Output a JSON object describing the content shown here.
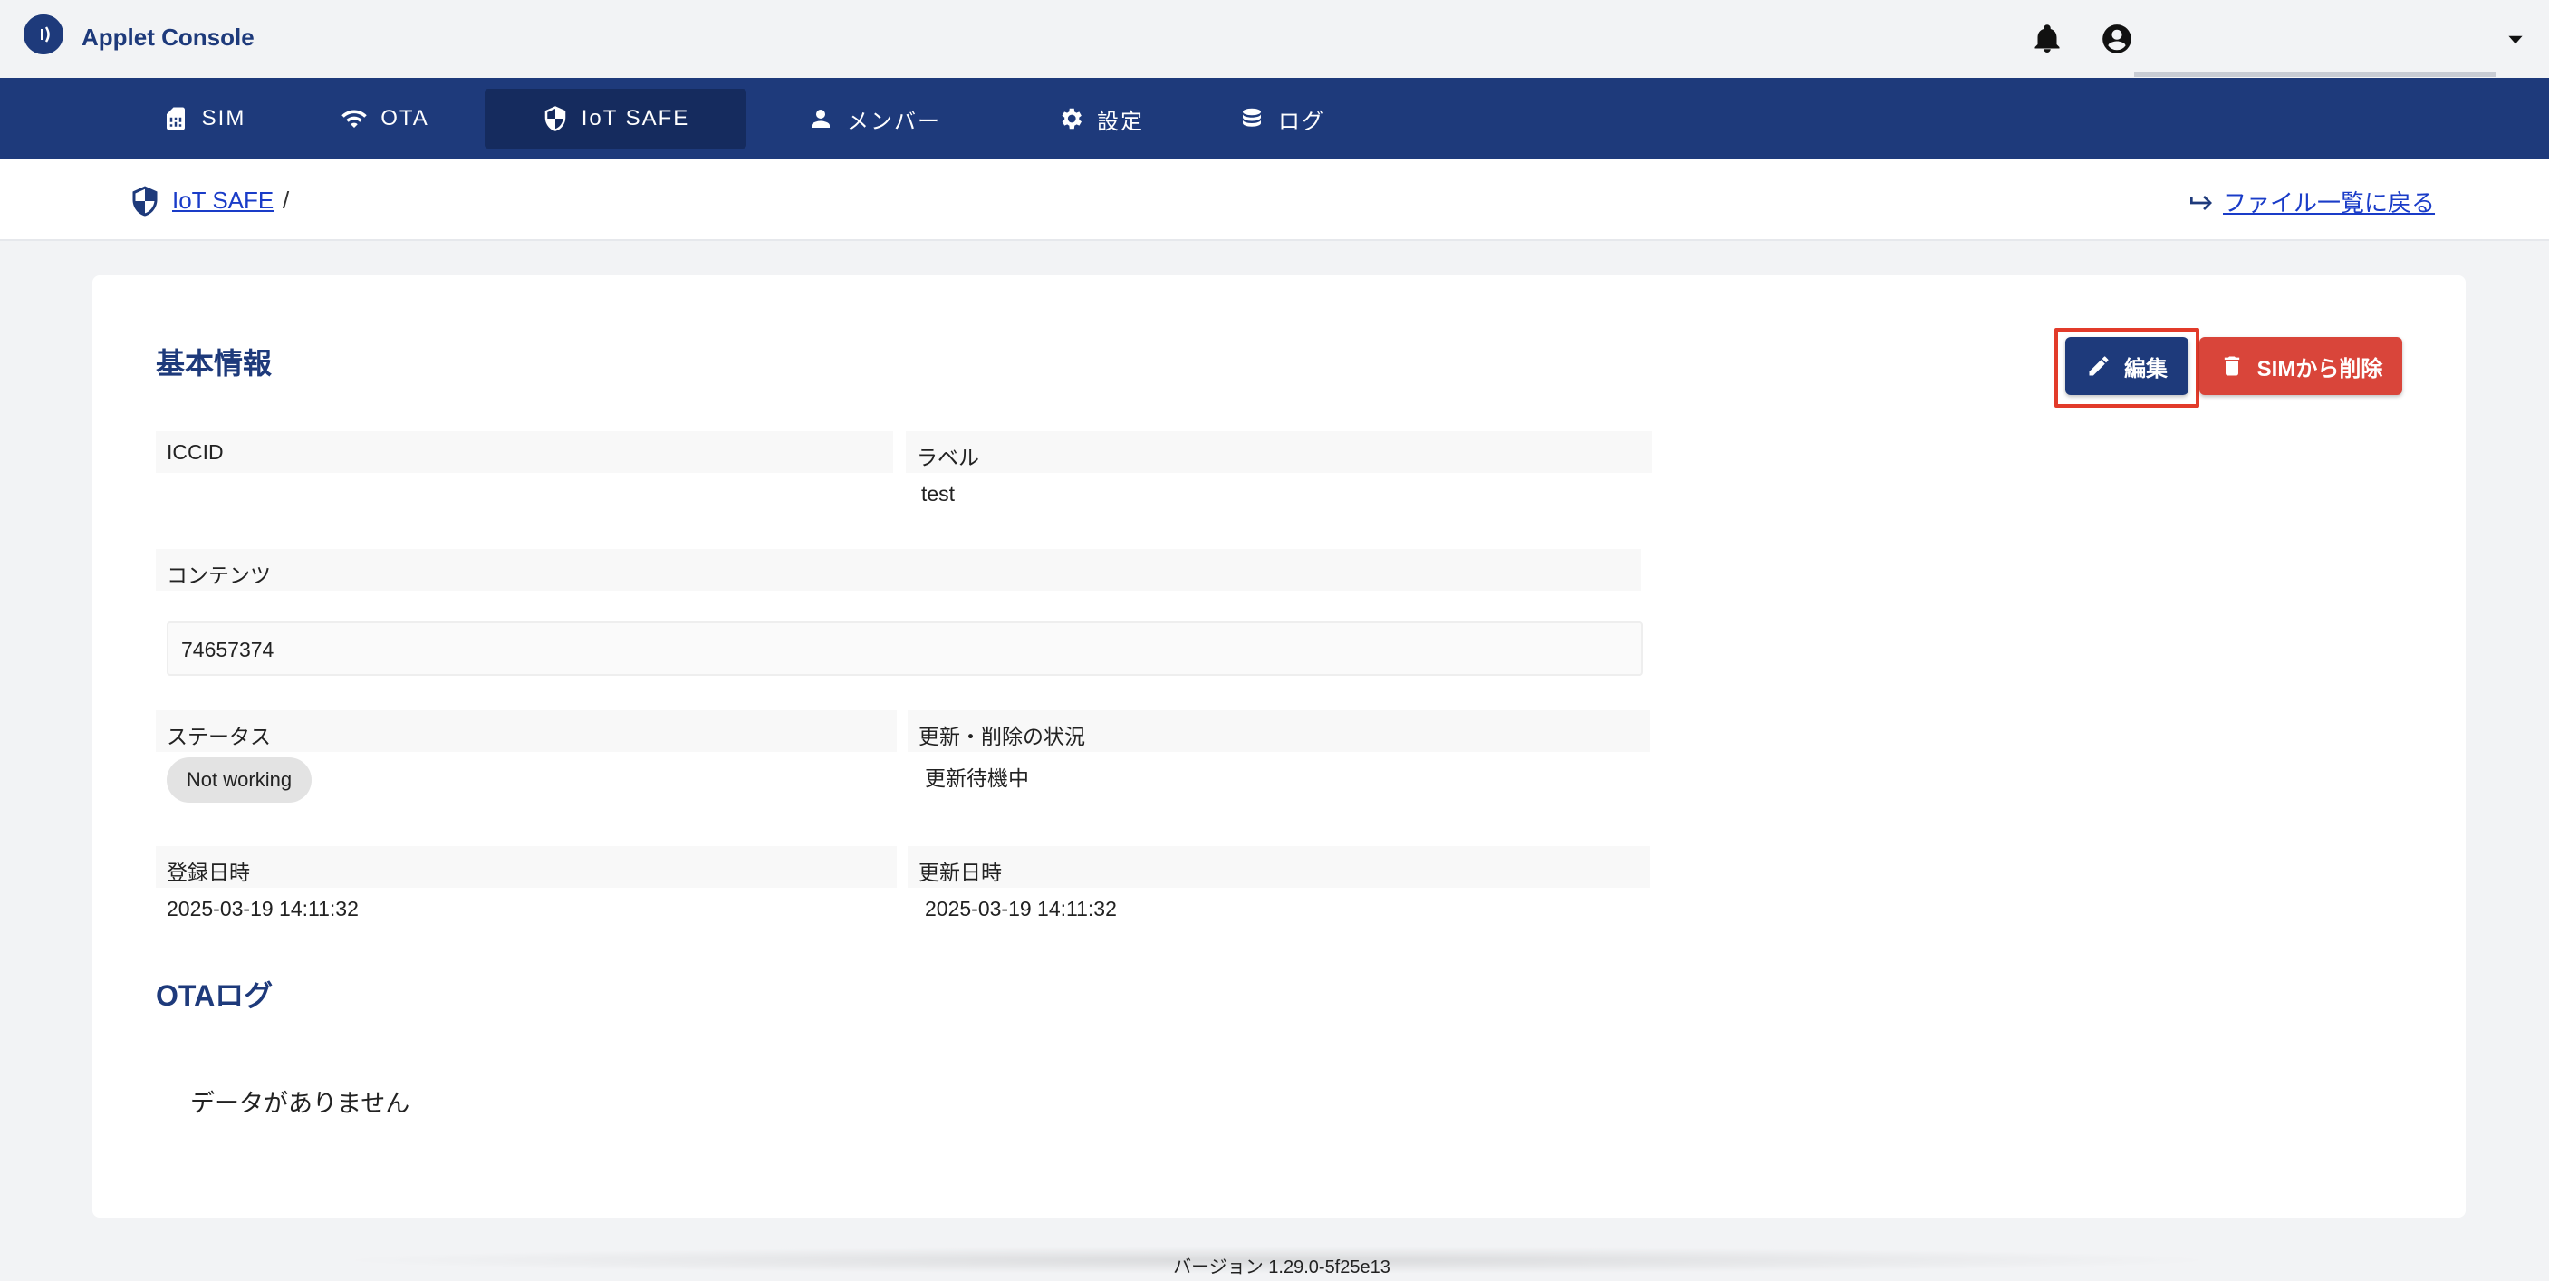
{
  "app": {
    "title": "Applet Console",
    "account_name": "                    "
  },
  "nav": {
    "tabs": [
      {
        "label": "SIM",
        "icon": "sim-card-icon"
      },
      {
        "label": "OTA",
        "icon": "wifi-icon"
      },
      {
        "label": "IoT SAFE",
        "icon": "shield-icon",
        "active": true
      },
      {
        "label": "メンバー",
        "icon": "person-icon"
      },
      {
        "label": "設定",
        "icon": "gear-icon"
      },
      {
        "label": "ログ",
        "icon": "database-icon"
      }
    ]
  },
  "breadcrumb": {
    "root": "IoT SAFE",
    "separator": "/",
    "current": "",
    "back_label": "ファイル一覧に戻る"
  },
  "basic_info": {
    "title": "基本情報",
    "edit_label": "編集",
    "delete_label": "SIMから削除",
    "iccid_label": "ICCID",
    "iccid_value": "",
    "label_label": "ラベル",
    "label_value": "test",
    "contents_label": "コンテンツ",
    "contents_value": "74657374",
    "status_label": "ステータス",
    "status_value": "Not working",
    "update_status_label": "更新・削除の状況",
    "update_status_value": "更新待機中",
    "registered_label": "登録日時",
    "registered_value": "2025-03-19 14:11:32",
    "updated_label": "更新日時",
    "updated_value": "2025-03-19 14:11:32"
  },
  "ota_log": {
    "title": "OTAログ",
    "empty": "データがありません"
  },
  "footer": {
    "version": "バージョン 1.29.0-5f25e13"
  },
  "colors": {
    "brand": "#1e3a7b",
    "danger": "#d9453a",
    "link": "#1a3cc8",
    "highlight": "#e23b2a"
  }
}
